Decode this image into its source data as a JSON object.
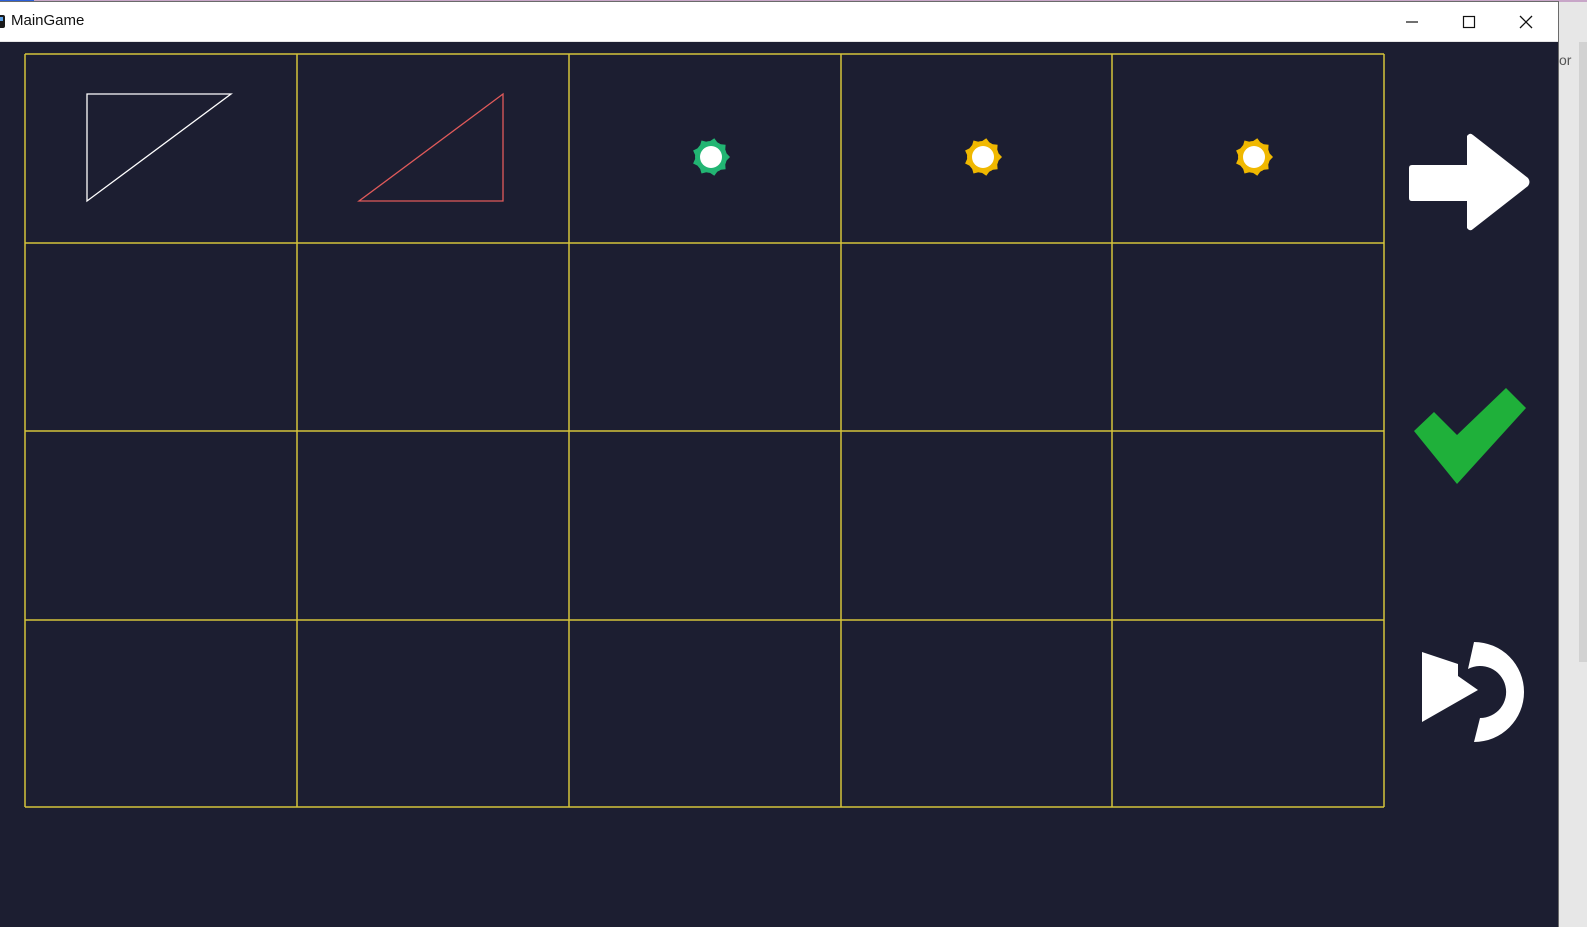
{
  "window": {
    "title": "MainGame",
    "controls": [
      "minimize-icon",
      "maximize-icon",
      "close-icon"
    ]
  },
  "board": {
    "rows": 4,
    "columns": 5,
    "grid_color": "#d4c33a",
    "background_color": "#1c1e31",
    "pieces": [
      {
        "row": 0,
        "col": 0,
        "type": "triangle",
        "orientation": "right-angle-top-left",
        "color": "#ffffff"
      },
      {
        "row": 0,
        "col": 1,
        "type": "triangle",
        "orientation": "right-angle-bottom-right",
        "color": "#e05a5a"
      },
      {
        "row": 0,
        "col": 2,
        "type": "token",
        "color": "#22b573"
      },
      {
        "row": 0,
        "col": 3,
        "type": "token",
        "color": "#f0b800"
      },
      {
        "row": 0,
        "col": 4,
        "type": "token",
        "color": "#f0b800"
      }
    ]
  },
  "controls": {
    "next": {
      "icon": "arrow-right-icon",
      "color": "#ffffff"
    },
    "confirm": {
      "icon": "checkmark-icon",
      "color": "#1fb03a"
    },
    "undo": {
      "icon": "undo-icon",
      "color": "#ffffff"
    }
  },
  "background_window_text": "or"
}
